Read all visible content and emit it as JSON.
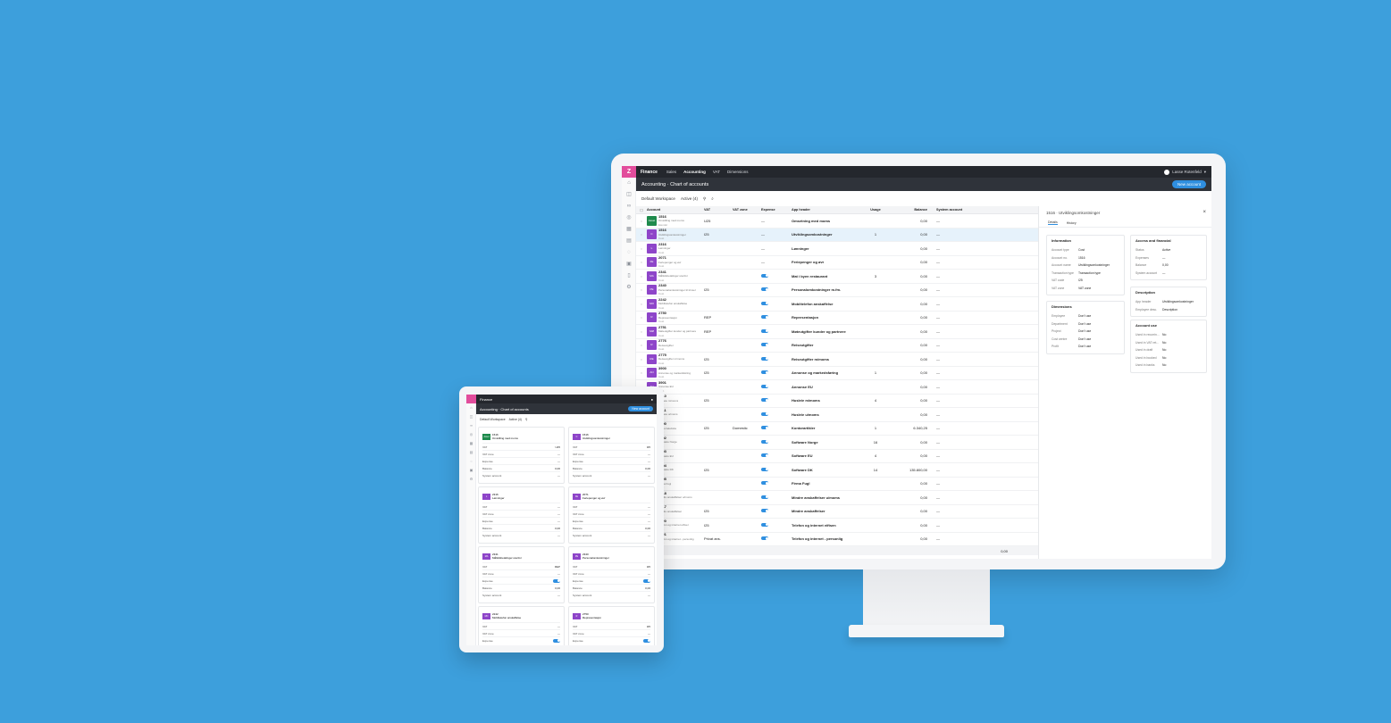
{
  "app": {
    "logo": "Z",
    "brand": "Finance",
    "nav": [
      "Sales",
      "Accounting",
      "VAT",
      "Dimensions"
    ],
    "active_nav": "Accounting",
    "user": "Lasse Rotenfeld",
    "breadcrumb": "Accounting · Chart of accounts",
    "new_account": "New account"
  },
  "toolbar": {
    "workspace": "Default Workspace",
    "filter": "Active (4)"
  },
  "table": {
    "headers": [
      "Account",
      "VAT",
      "VAT zone",
      "Expense",
      "App header",
      "Usage",
      "Balance",
      "System account"
    ],
    "rows": [
      {
        "num": "1516",
        "name": "Omstilling med moms",
        "type": "Eiendel",
        "badge": "Asset",
        "color": "#1e8a4c",
        "vat": "U25",
        "vatzone": "",
        "expense": false,
        "app": "Omsetning med moms",
        "usage": "",
        "balance": "0,00",
        "sys": "—"
      },
      {
        "num": "1516",
        "name": "Utviklingsomkostninger",
        "type": "Cost",
        "badge": "C",
        "color": "#8e45c9",
        "vat": "I25",
        "vatzone": "",
        "expense": false,
        "app": "Utviklingsomkostninger",
        "usage": "1",
        "balance": "0,00",
        "sys": "—"
      },
      {
        "num": "2316",
        "name": "Lønninger",
        "type": "Cost",
        "badge": "L",
        "color": "#8e45c9",
        "vat": "",
        "vatzone": "",
        "expense": false,
        "app": "Lønninger",
        "usage": "",
        "balance": "0,00",
        "sys": "—"
      },
      {
        "num": "2071",
        "name": "Feriepenger og øvr",
        "type": "Cost",
        "badge": "FE",
        "color": "#8e45c9",
        "vat": "",
        "vatzone": "",
        "expense": false,
        "app": "Feriepenger og øvr",
        "usage": "",
        "balance": "0,00",
        "sys": "—"
      },
      {
        "num": "2341",
        "name": "Måltidsbetalinger utenfor",
        "type": "Cost",
        "badge": "MA",
        "color": "#8e45c9",
        "vat": "",
        "vatzone": "",
        "expense": true,
        "app": "Mat i byen restaurant",
        "usage": "3",
        "balance": "0,00",
        "sys": "—"
      },
      {
        "num": "2340",
        "name": "Personalomkostninger til trivsel",
        "type": "Cost",
        "badge": "PE",
        "color": "#8e45c9",
        "vat": "I25",
        "vatzone": "",
        "expense": true,
        "app": "Personalomkostninger m.fm.",
        "usage": "",
        "balance": "0,00",
        "sys": "—"
      },
      {
        "num": "2242",
        "name": "Mobiltelefon anskaffelse",
        "type": "Cost",
        "badge": "MO",
        "color": "#8e45c9",
        "vat": "",
        "vatzone": "",
        "expense": true,
        "app": "Mobiltelefon anskaffelse",
        "usage": "",
        "balance": "0,00",
        "sys": "—"
      },
      {
        "num": "2750",
        "name": "Representasjon",
        "type": "Cost",
        "badge": "R",
        "color": "#8e45c9",
        "vat": "REP",
        "vatzone": "",
        "expense": true,
        "app": "Representasjon",
        "usage": "",
        "balance": "0,00",
        "sys": "—"
      },
      {
        "num": "2751",
        "name": "Møteutgifter kunder og partnere",
        "type": "Cost",
        "badge": "MØ",
        "color": "#8e45c9",
        "vat": "REP",
        "vatzone": "",
        "expense": true,
        "app": "Møteutgifter kunder og partnere",
        "usage": "",
        "balance": "0,00",
        "sys": "—"
      },
      {
        "num": "2776",
        "name": "Reiseutgifter",
        "type": "Cost",
        "badge": "R",
        "color": "#8e45c9",
        "vat": "",
        "vatzone": "",
        "expense": true,
        "app": "Reiseutgifter",
        "usage": "",
        "balance": "0,00",
        "sys": "—"
      },
      {
        "num": "2775",
        "name": "Reiseutgifter m/moms",
        "type": "Cost",
        "badge": "RE",
        "color": "#8e45c9",
        "vat": "I25",
        "vatzone": "",
        "expense": true,
        "app": "Reiseutgifter m/moms",
        "usage": "",
        "balance": "0,00",
        "sys": "—"
      },
      {
        "num": "3900",
        "name": "Annonse og markedsføring",
        "type": "Cost",
        "badge": "AN",
        "color": "#8e45c9",
        "vat": "I25",
        "vatzone": "",
        "expense": true,
        "app": "Annonse og markedsføring",
        "usage": "1",
        "balance": "0,00",
        "sys": "—"
      },
      {
        "num": "3901",
        "name": "Annonse EU",
        "type": "Cost",
        "badge": "AN",
        "color": "#8e45c9",
        "vat": "",
        "vatzone": "",
        "expense": true,
        "app": "Annonse EU",
        "usage": "",
        "balance": "0,00",
        "sys": "—"
      },
      {
        "num": "3610",
        "name": "Husleie m/moms",
        "type": "Cost",
        "badge": "HU",
        "color": "#8e45c9",
        "vat": "I25",
        "vatzone": "",
        "expense": true,
        "app": "Husleie m/moms",
        "usage": "4",
        "balance": "0,00",
        "sys": "—"
      },
      {
        "num": "3611",
        "name": "Husleie u/moms",
        "type": "Cost",
        "badge": "HU",
        "color": "#8e45c9",
        "vat": "",
        "vatzone": "",
        "expense": true,
        "app": "Husleie u/moms",
        "usage": "",
        "balance": "0,00",
        "sys": "—"
      },
      {
        "num": "3600",
        "name": "Kontorrekvisita",
        "type": "Cost",
        "badge": "KO",
        "color": "#8e45c9",
        "vat": "I25",
        "vatzone": "Domestic",
        "expense": true,
        "app": "Kontorartikler",
        "usage": "1",
        "balance": "6.340,25",
        "sys": "—"
      },
      {
        "num": "3602",
        "name": "Software Norge",
        "type": "Cost",
        "badge": "SO",
        "color": "#8e45c9",
        "vat": "",
        "vatzone": "",
        "expense": true,
        "app": "Software Norge",
        "usage": "16",
        "balance": "0,00",
        "sys": "—"
      },
      {
        "num": "3603",
        "name": "Software EU",
        "type": "Cost",
        "badge": "SO",
        "color": "#8e45c9",
        "vat": "",
        "vatzone": "",
        "expense": true,
        "app": "Software EU",
        "usage": "4",
        "balance": "0,00",
        "sys": "—"
      },
      {
        "num": "3604",
        "name": "Software DK",
        "type": "Cost",
        "badge": "SO",
        "color": "#8e45c9",
        "vat": "I25",
        "vatzone": "",
        "expense": true,
        "app": "Software DK",
        "usage": "14",
        "balance": "135.800,00",
        "sys": "—"
      },
      {
        "num": "3605",
        "name": "Firma Fugl",
        "type": "Cost",
        "badge": "FI",
        "color": "#8e45c9",
        "vat": "",
        "vatzone": "",
        "expense": true,
        "app": "Firma Fugl",
        "usage": "",
        "balance": "0,00",
        "sys": "—"
      },
      {
        "num": "3618",
        "name": "Mindre anskaffelser u/moms",
        "type": "Cost",
        "badge": "MI",
        "color": "#8e45c9",
        "vat": "",
        "vatzone": "",
        "expense": true,
        "app": "Mindre anskaffelser u/moms",
        "usage": "",
        "balance": "0,00",
        "sys": "—"
      },
      {
        "num": "3617",
        "name": "Mindre anskaffelser",
        "type": "Cost",
        "badge": "MI",
        "color": "#8e45c9",
        "vat": "I25",
        "vatzone": "",
        "expense": true,
        "app": "Mindre anskaffelser",
        "usage": "",
        "balance": "0,00",
        "sys": "—"
      },
      {
        "num": "3620",
        "name": "Telefon og internet eiftsen",
        "type": "Cost",
        "badge": "TE",
        "color": "#8e45c9",
        "vat": "I25",
        "vatzone": "",
        "expense": true,
        "app": "Telefon og internet eiftsen",
        "usage": "",
        "balance": "0,00",
        "sys": "—"
      },
      {
        "num": "3621",
        "name": "Telefon og internet - personlig",
        "type": "Cost",
        "badge": "TE",
        "color": "#8e45c9",
        "vat": "Privat ans.",
        "vatzone": "",
        "expense": true,
        "app": "Telefon og internet - personlig",
        "usage": "",
        "balance": "0,00",
        "sys": "—"
      }
    ],
    "total": "0,00"
  },
  "detail": {
    "title": "1516 · Utviklingsomkostninger",
    "tabs": [
      "Details",
      "History"
    ],
    "information": {
      "heading": "Information",
      "rows": [
        [
          "Account type",
          "Cost"
        ],
        [
          "Account no.",
          "1516"
        ],
        [
          "Account name",
          "Utviklingsomkostninger"
        ],
        [
          "Transaction type",
          "Transaction type"
        ],
        [
          "VAT code",
          "I25"
        ],
        [
          "VAT zone",
          "VAT zone"
        ]
      ]
    },
    "dimensions": {
      "heading": "Dimensions",
      "rows": [
        [
          "Employee",
          "Don't use"
        ],
        [
          "Department",
          "Don't use"
        ],
        [
          "Project",
          "Don't use"
        ],
        [
          "Cost centre",
          "Don't use"
        ],
        [
          "Profit",
          "Don't use"
        ]
      ]
    },
    "access": {
      "heading": "Access and financial",
      "rows": [
        [
          "Status",
          "Active"
        ],
        [
          "Expenses",
          "—"
        ],
        [
          "Balance",
          "0,00"
        ],
        [
          "System account",
          "—"
        ]
      ]
    },
    "description": {
      "heading": "Description",
      "rows": [
        [
          "App header",
          "Utviklingsomkostninger"
        ],
        [
          "Employee desc.",
          "Description"
        ]
      ]
    },
    "usage": {
      "heading": "Account use",
      "rows": [
        [
          "Used in recurrin...",
          "No"
        ],
        [
          "Used in VAT ret...",
          "No"
        ],
        [
          "Used in draft",
          "No"
        ],
        [
          "Used in booked",
          "No"
        ],
        [
          "Used in banks",
          "No"
        ]
      ]
    }
  },
  "tablet": {
    "brand": "Finance",
    "breadcrumb": "Accounting · Chart of accounts",
    "new_account": "New account",
    "workspace": "Default Workspace",
    "filter": "Active (4)",
    "cards": [
      {
        "num": "1516",
        "name": "Omstilling med moms",
        "badge": "Asset",
        "color": "#1e8a4c",
        "rows": [
          [
            "VAT",
            "U25"
          ],
          [
            "VAT zone",
            "—"
          ],
          [
            "Expense",
            "—"
          ],
          [
            "Balance",
            "0,00"
          ],
          [
            "System account",
            "—"
          ]
        ]
      },
      {
        "num": "1516",
        "name": "Utviklingsomkostninger",
        "badge": "C",
        "color": "#8e45c9",
        "rows": [
          [
            "VAT",
            "I25"
          ],
          [
            "VAT zone",
            "—"
          ],
          [
            "Expense",
            "—"
          ],
          [
            "Balance",
            "0,00"
          ],
          [
            "System account",
            "—"
          ]
        ]
      },
      {
        "num": "2316",
        "name": "Lønninger",
        "badge": "L",
        "color": "#8e45c9",
        "rows": [
          [
            "VAT",
            "—"
          ],
          [
            "VAT zone",
            "—"
          ],
          [
            "Expense",
            "—"
          ],
          [
            "Balance",
            "0,00"
          ],
          [
            "System account",
            "—"
          ]
        ]
      },
      {
        "num": "2071",
        "name": "Feriepenger og øvr",
        "badge": "FE",
        "color": "#8e45c9",
        "rows": [
          [
            "VAT",
            "—"
          ],
          [
            "VAT zone",
            "—"
          ],
          [
            "Expense",
            "—"
          ],
          [
            "Balance",
            "0,00"
          ],
          [
            "System account",
            "—"
          ]
        ]
      },
      {
        "num": "2341",
        "name": "Måltidsbetalinger utenfor",
        "badge": "MA",
        "color": "#8e45c9",
        "rows": [
          [
            "VAT",
            "REP"
          ],
          [
            "VAT zone",
            "—"
          ],
          [
            "Expense",
            "on"
          ],
          [
            "Balance",
            "0,00"
          ],
          [
            "System account",
            "—"
          ]
        ]
      },
      {
        "num": "2340",
        "name": "Personalomkostninger",
        "badge": "PE",
        "color": "#8e45c9",
        "rows": [
          [
            "VAT",
            "I25"
          ],
          [
            "VAT zone",
            "—"
          ],
          [
            "Expense",
            "on"
          ],
          [
            "Balance",
            "0,00"
          ],
          [
            "System account",
            "—"
          ]
        ]
      },
      {
        "num": "2242",
        "name": "Mobiltelefon anskaffelse",
        "badge": "MO",
        "color": "#8e45c9",
        "rows": [
          [
            "VAT",
            "—"
          ],
          [
            "VAT zone",
            "—"
          ],
          [
            "Expense",
            "on"
          ]
        ]
      },
      {
        "num": "2750",
        "name": "Representasjon",
        "badge": "R",
        "color": "#8e45c9",
        "rows": [
          [
            "VAT",
            "I25"
          ],
          [
            "VAT zone",
            "—"
          ],
          [
            "Expense",
            "on"
          ]
        ]
      }
    ]
  }
}
